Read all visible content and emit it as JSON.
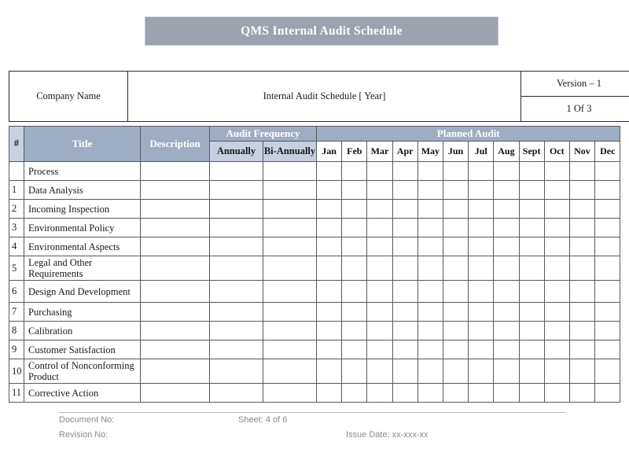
{
  "banner": {
    "title": "QMS Internal Audit Schedule",
    "background_color": "#9aa3ae",
    "text_color": "#ffffff"
  },
  "info_header": {
    "company_label": "Company Name",
    "document_title": "Internal Audit Schedule [ Year]",
    "version": "Version – 1",
    "page": "1 Of 3"
  },
  "table": {
    "colors": {
      "header_dark": "#9fadc2",
      "header_light": "#c7d0df",
      "border": "#555a60"
    },
    "headers": {
      "number": "#",
      "title": "Title",
      "description": "Description",
      "audit_frequency": "Audit Frequency",
      "annually": "Annually",
      "bi_annually": "Bi-Annually",
      "planned_audit": "Planned Audit"
    },
    "months": [
      "Jan",
      "Feb",
      "Mar",
      "Apr",
      "May",
      "Jun",
      "Jul",
      "Aug",
      "Sept",
      "Oct",
      "Nov",
      "Dec"
    ],
    "rows": [
      {
        "num": "",
        "title": "Process",
        "lines": 1
      },
      {
        "num": "1",
        "title": "Data Analysis",
        "lines": 1
      },
      {
        "num": "2",
        "title": "Incoming Inspection",
        "lines": 1
      },
      {
        "num": "3",
        "title": "Environmental Policy",
        "lines": 1
      },
      {
        "num": "4",
        "title": "Environmental Aspects",
        "lines": 1
      },
      {
        "num": "5",
        "title": "Legal and Other Requirements",
        "lines": 2
      },
      {
        "num": "6",
        "title": "Design And Development",
        "lines": 2
      },
      {
        "num": "7",
        "title": "Purchasing",
        "lines": 1
      },
      {
        "num": "8",
        "title": "Calibration",
        "lines": 1
      },
      {
        "num": "9",
        "title": "Customer Satisfaction",
        "lines": 1
      },
      {
        "num": "10",
        "title": "Control of Nonconforming Product",
        "lines": 2
      },
      {
        "num": "11",
        "title": "Corrective Action",
        "lines": 1
      }
    ]
  },
  "footer": {
    "document_no": "Document No:",
    "sheet": "Sheet: 4 of 6",
    "revision_no": "Revision No:",
    "issue_date": "Issue Date: xx-xxx-xx"
  }
}
